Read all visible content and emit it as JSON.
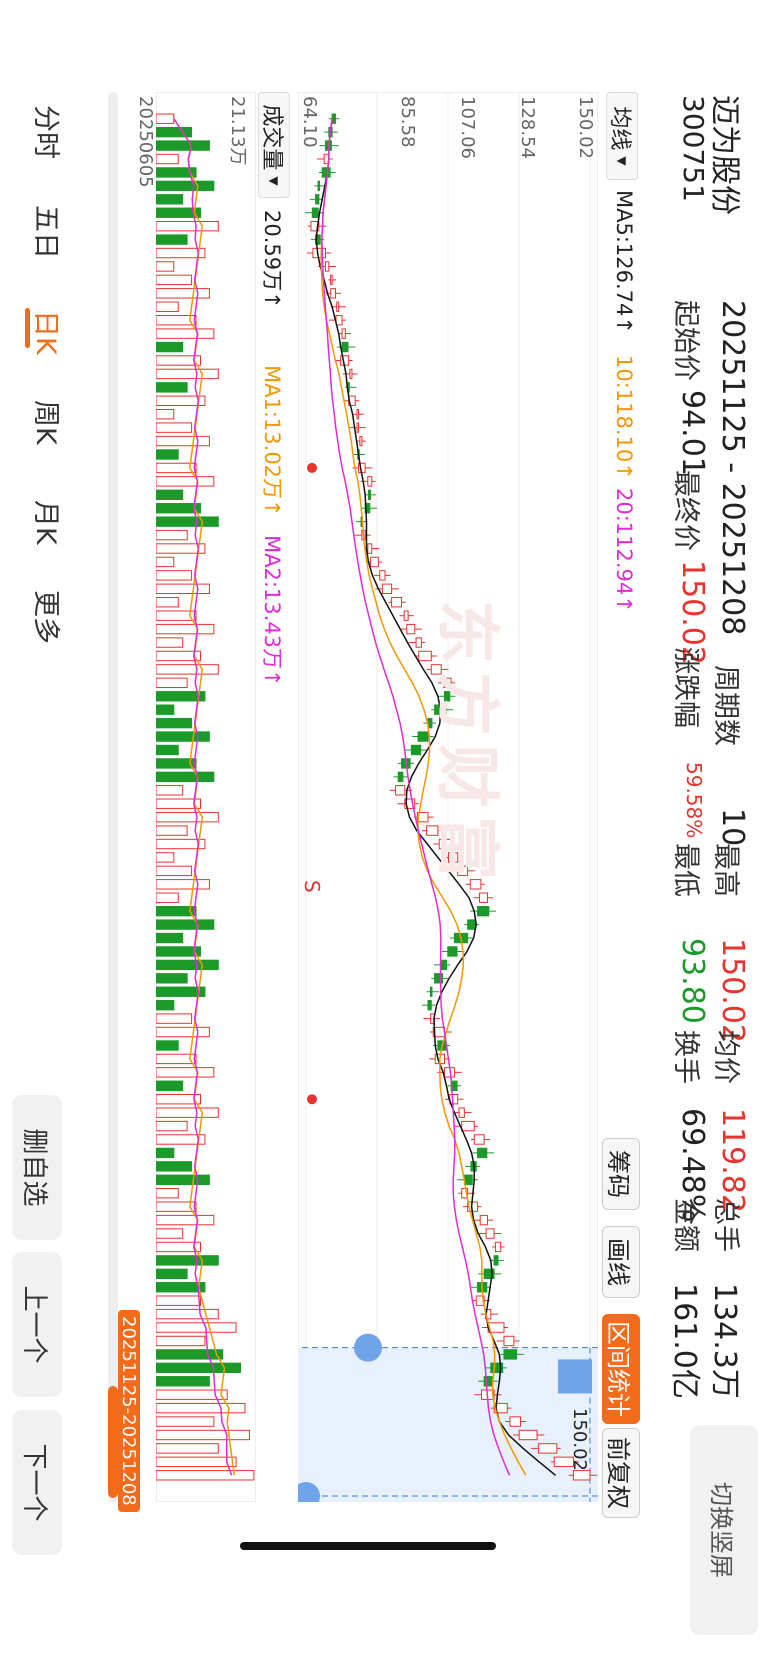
{
  "header": {
    "stock_name": "迈为股份",
    "stock_code": "300751",
    "range": "20251125 - 20251208",
    "periods_label": "周期数",
    "periods_value": "10",
    "high_label": "最高",
    "high_value": "150.02",
    "avg_label": "均价",
    "avg_value": "119.82",
    "total_hands_label": "总手",
    "total_hands_value": "134.3万",
    "start_label": "起始价",
    "start_value": "94.01",
    "end_label": "最终价",
    "end_value": "150.02",
    "change_label": "涨跌幅",
    "change_value": "59.58%",
    "low_label": "最低",
    "low_value": "93.80",
    "turnover_label": "换手",
    "turnover_value": "69.48%",
    "amount_label": "金额",
    "amount_value": "161.0亿"
  },
  "switch_screen": "切换竖屏",
  "toolbar": {
    "chips_label": "筹码",
    "draw_label": "画线",
    "range_stats_label": "区间统计",
    "adjust_label": "前复权"
  },
  "price_panel": {
    "indicator_select": "均线",
    "ma5": "MA5:126.74↑",
    "ma10": "10:118.10↑",
    "ma20": "20:112.94↑",
    "y_ticks": [
      "150.02",
      "128.54",
      "107.06",
      "85.58",
      "64.10"
    ],
    "low_marker": "64.10",
    "range_high_marker": "150.02",
    "signal_s": "S",
    "watermark": "东方财富"
  },
  "volume_panel": {
    "indicator_select": "成交量",
    "vol": "20.59万↑",
    "ma1": "MA1:13.02万↑",
    "ma2": "MA2:13.43万↑",
    "y_top": "21.13万",
    "start_date": "20250605",
    "range_badge": "20251125-20251208"
  },
  "tabs": [
    "分时",
    "五日",
    "日K",
    "周K",
    "月K",
    "更多"
  ],
  "active_tab": "日K",
  "side_buttons": {
    "remove": "删自选",
    "prev": "上一个",
    "next": "下一个"
  },
  "colors": {
    "accent": "#f46b1c",
    "up": "#e8332e",
    "down": "#1b9a2a",
    "ma5": "#111111",
    "ma10": "#f39800",
    "ma20": "#e02bd6"
  },
  "chart_data": {
    "type": "candlestick",
    "ylim": [
      64.1,
      150.02
    ],
    "y_ticks": [
      150.02,
      128.54,
      107.06,
      85.58,
      64.1
    ],
    "volume_ylim": [
      0,
      21.13
    ],
    "volume_unit": "万",
    "range_start": "20251125",
    "range_end": "20251208",
    "close": [
      72,
      71,
      70,
      71,
      69,
      68,
      67,
      66,
      68,
      67,
      70,
      71,
      72,
      73,
      74,
      75,
      76,
      75,
      77,
      78,
      77,
      79,
      80,
      80,
      81,
      80,
      82,
      84,
      83,
      82,
      81,
      82,
      84,
      86,
      88,
      90,
      93,
      95,
      97,
      99,
      102,
      105,
      108,
      106,
      103,
      101,
      98,
      96,
      93,
      92,
      94,
      97,
      101,
      104,
      108,
      110,
      113,
      117,
      119,
      116,
      113,
      109,
      107,
      105,
      103,
      102,
      101,
      103,
      106,
      104,
      106,
      109,
      108,
      110,
      112,
      115,
      118,
      116,
      114,
      112,
      113,
      116,
      119,
      121,
      123,
      121,
      118,
      116,
      118,
      120,
      124,
      127,
      124,
      120,
      118,
      121,
      125,
      129,
      134,
      140,
      145,
      150
    ]
  }
}
